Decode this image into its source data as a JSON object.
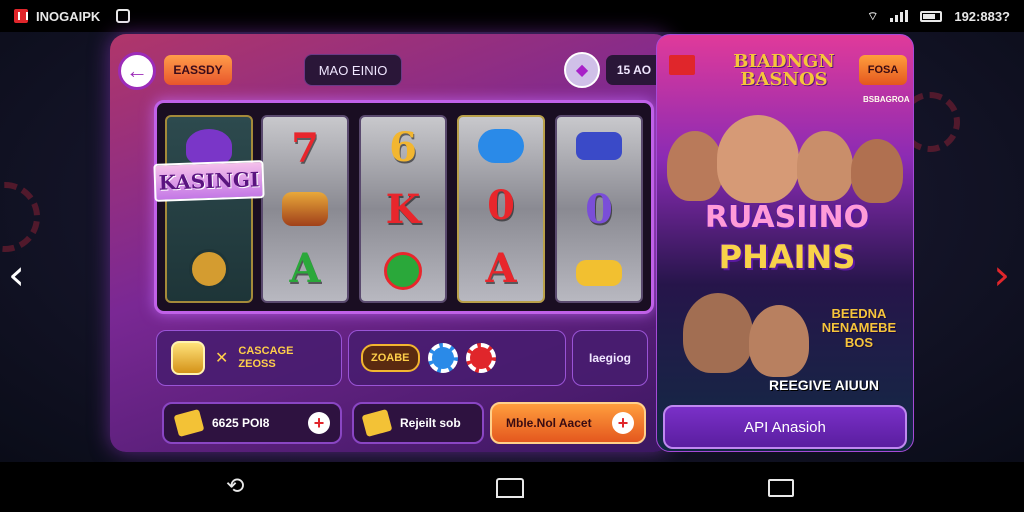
{
  "status_bar": {
    "app_name": "INOGAIPK",
    "clock": "192:883?"
  },
  "game": {
    "back_icon": "arrow-left-icon",
    "top_left_button": "EASSDY",
    "title": "MAO EINIO",
    "gem_icon": "diamond-icon",
    "balance": "15 AO",
    "logo_text": "KASINGI",
    "reels": [
      [
        "hat-symbol",
        "crown-symbol",
        "compass-symbol"
      ],
      [
        "7",
        "chest-symbol",
        "A"
      ],
      [
        "6",
        "K",
        "cherry-symbol"
      ],
      [
        "cloud-symbol",
        "0",
        "A"
      ],
      [
        "car-symbol",
        "0",
        "gold-symbol"
      ]
    ],
    "bonus_promo": "CASCAGE\nZEOSS",
    "chips_label": "ZOABE",
    "tag_button": "Iaegiog",
    "coins_button": "6625 POI8",
    "rebet_button": "Rejeilt sob",
    "orange_button": "Mble.Nol Aacet",
    "colors": {
      "accent_purple": "#7a2894",
      "accent_orange": "#e4571e",
      "gold": "#f2b630"
    }
  },
  "ad": {
    "title": "BIADNGN\nBASNOS",
    "pill": "FOSA",
    "sub": "BSBAGROA",
    "headline_1": "RUASIINO",
    "headline_2": "PHAINS",
    "promo": "BEEDNA\nNENAMEBE\nBOS",
    "caption": "REEGIVE AIUUN",
    "cta": "API Anasioh"
  },
  "nav": {
    "back": "back-icon",
    "home": "home-icon",
    "recent": "recent-apps-icon"
  }
}
